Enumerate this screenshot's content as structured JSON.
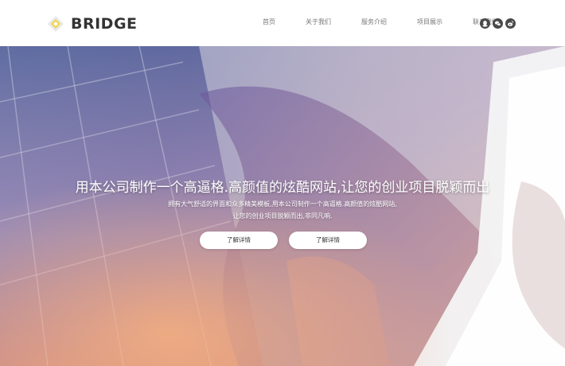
{
  "brand": {
    "name": "BRIDGE"
  },
  "nav": {
    "items": [
      "首页",
      "关于我们",
      "服务介绍",
      "项目展示",
      "联系我们"
    ]
  },
  "socials": [
    {
      "icon": "qq-icon"
    },
    {
      "icon": "wechat-icon"
    },
    {
      "icon": "weibo-icon"
    }
  ],
  "hero": {
    "title": "用本公司制作一个高逼格.高颜值的炫酷网站,让您的创业项目脱颖而出",
    "subtitle_line1": "拥有大气舒适的界面和众多精美模板,用本公司制作一个高逼格.高颜值的炫酷网站,",
    "subtitle_line2": "让您的创业项目脱颖而出,非同凡响.",
    "button1": "了解详情",
    "button2": "了解详情"
  },
  "colors": {
    "logo_yellow": "#f2d34a",
    "text_dark": "#333333",
    "nav_text": "#777777",
    "social_bg": "#4a4a4a",
    "hero_purple": "#6b5a9e",
    "hero_orange": "#e89a6a"
  }
}
